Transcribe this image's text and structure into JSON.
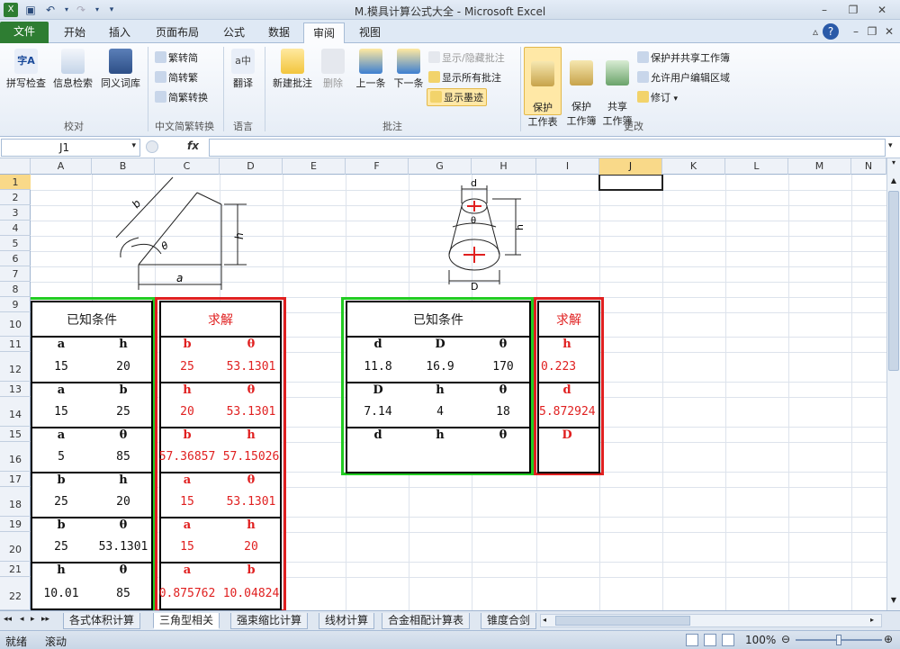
{
  "window": {
    "title": "M.模具计算公式大全 - Microsoft Excel"
  },
  "tabs": [
    {
      "label": "文件"
    },
    {
      "label": "开始"
    },
    {
      "label": "插入"
    },
    {
      "label": "页面布局"
    },
    {
      "label": "公式"
    },
    {
      "label": "数据"
    },
    {
      "label": "审阅"
    },
    {
      "label": "视图"
    }
  ],
  "ribbon": {
    "proofing": {
      "spell": "拼写检查",
      "research": "信息检索",
      "thesaurus": "同义词库",
      "group": "校对"
    },
    "chinese": {
      "to_trad": "繁转简",
      "to_simp": "简转繁",
      "convert": "简繁转换",
      "group": "中文简繁转换"
    },
    "language": {
      "translate": "翻译",
      "group": "语言"
    },
    "comments": {
      "new": "新建批注",
      "delete": "删除",
      "prev": "上一条",
      "next": "下一条",
      "show_hide": "显示/隐藏批注",
      "show_all": "显示所有批注",
      "show_ink": "显示墨迹",
      "group": "批注"
    },
    "changes": {
      "protect_sheet": "保护\n工作表",
      "protect_wb": "保护\n工作簿",
      "share_wb": "共享\n工作簿",
      "protect_share": "保护并共享工作簿",
      "allow_edit": "允许用户编辑区域",
      "track": "修订",
      "group": "更改"
    }
  },
  "formula_bar": {
    "name_box": "J1",
    "fx": "fx",
    "formula": ""
  },
  "columns": [
    "A",
    "B",
    "C",
    "D",
    "E",
    "F",
    "G",
    "H",
    "I",
    "J",
    "K",
    "L",
    "M",
    "N"
  ],
  "rows": [
    "1",
    "2",
    "3",
    "4",
    "5",
    "6",
    "7",
    "8",
    "9",
    "10",
    "11",
    "12",
    "13",
    "14",
    "15",
    "16",
    "17",
    "18",
    "19",
    "20",
    "21",
    "22"
  ],
  "diagram_left_labels": {
    "b": "b",
    "theta": "θ",
    "h": "h",
    "a": "a"
  },
  "diagram_right_labels": {
    "d": "d",
    "theta": "θ",
    "h": "h",
    "D": "D"
  },
  "left_table": {
    "known_title": "已知条件",
    "solve_title": "求解",
    "blocks": [
      {
        "known_h": [
          "a",
          "h"
        ],
        "known_v": [
          "15",
          "20"
        ],
        "solve_h": [
          "b",
          "θ"
        ],
        "solve_v": [
          "25",
          "53.1301"
        ]
      },
      {
        "known_h": [
          "a",
          "b"
        ],
        "known_v": [
          "15",
          "25"
        ],
        "solve_h": [
          "h",
          "θ"
        ],
        "solve_v": [
          "20",
          "53.1301"
        ]
      },
      {
        "known_h": [
          "a",
          "θ"
        ],
        "known_v": [
          "5",
          "85"
        ],
        "solve_h": [
          "b",
          "h"
        ],
        "solve_v": [
          "57.36857",
          "57.15026"
        ]
      },
      {
        "known_h": [
          "b",
          "h"
        ],
        "known_v": [
          "25",
          "20"
        ],
        "solve_h": [
          "a",
          "θ"
        ],
        "solve_v": [
          "15",
          "53.1301"
        ]
      },
      {
        "known_h": [
          "b",
          "θ"
        ],
        "known_v": [
          "25",
          "53.1301"
        ],
        "solve_h": [
          "a",
          "h"
        ],
        "solve_v": [
          "15",
          "20"
        ]
      },
      {
        "known_h": [
          "h",
          "θ"
        ],
        "known_v": [
          "10.01",
          "85"
        ],
        "solve_h": [
          "a",
          "b"
        ],
        "solve_v": [
          "0.875762",
          "10.04824"
        ]
      }
    ]
  },
  "right_table": {
    "known_title": "已知条件",
    "solve_title": "求解",
    "blocks": [
      {
        "known_h": [
          "d",
          "D",
          "θ"
        ],
        "known_v": [
          "11.8",
          "16.9",
          "170"
        ],
        "solve_h": "h",
        "solve_v": "0.223"
      },
      {
        "known_h": [
          "D",
          "h",
          "θ"
        ],
        "known_v": [
          "7.14",
          "4",
          "18"
        ],
        "solve_h": "d",
        "solve_v": "5.872924"
      },
      {
        "known_h": [
          "d",
          "h",
          "θ"
        ],
        "known_v": [
          "",
          "",
          ""
        ],
        "solve_h": "D",
        "solve_v": ""
      }
    ]
  },
  "sheet_tabs": [
    "各式体积计算",
    "三角型相关",
    "强束缩比计算",
    "线材计算",
    "合金相配计算表",
    "锥度合剑"
  ],
  "status": {
    "ready": "就绪",
    "scroll": "滚动",
    "zoom": "100%"
  },
  "colors": {
    "green": "#22cc22",
    "red": "#e02020",
    "file_tab": "#2e7d32"
  }
}
